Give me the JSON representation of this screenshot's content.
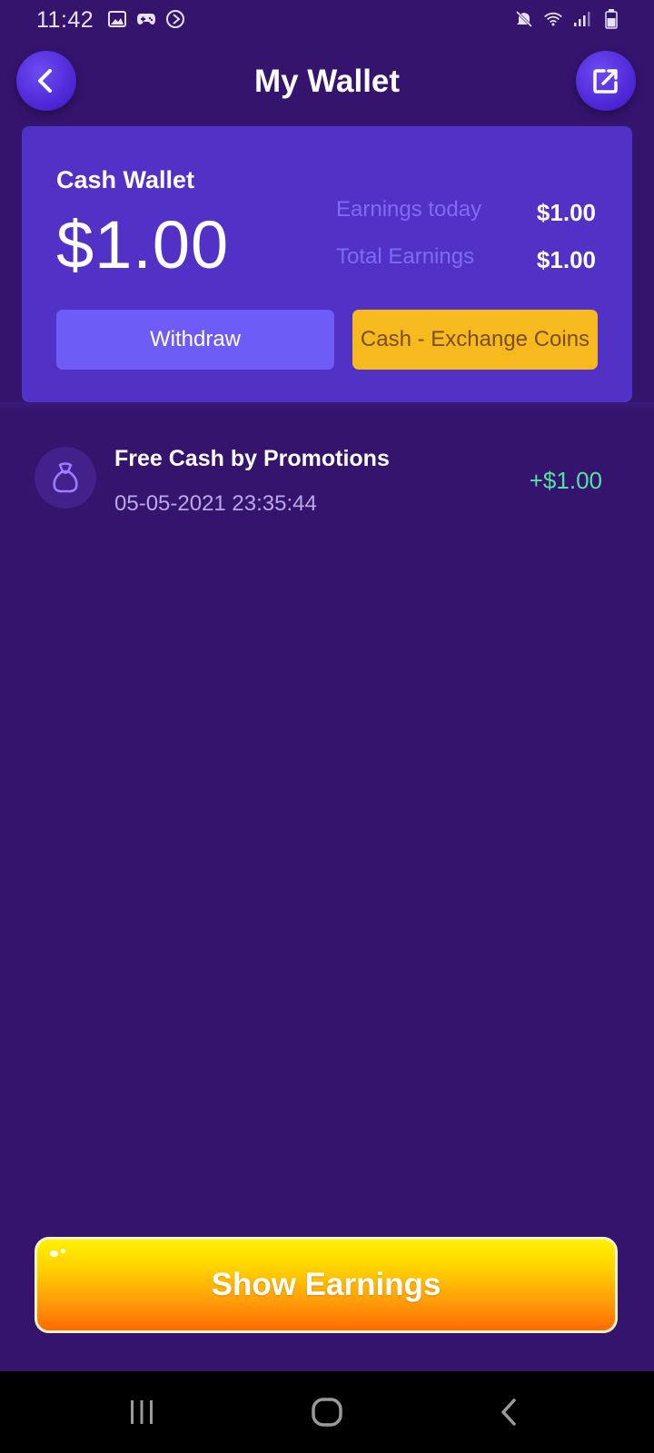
{
  "status_bar": {
    "time": "11:42",
    "left_icons": [
      "image-icon",
      "gamepad-icon",
      "play-circle-icon"
    ],
    "right_icons": [
      "mute-icon",
      "wifi-icon",
      "signal-icon",
      "battery-icon"
    ]
  },
  "header": {
    "title": "My Wallet",
    "back_icon": "chevron-left-icon",
    "share_icon": "external-link-icon"
  },
  "wallet": {
    "label": "Cash Wallet",
    "balance": "$1.00",
    "earnings_today_label": "Earnings today",
    "earnings_today_value": "$1.00",
    "total_earnings_label": "Total Earnings",
    "total_earnings_value": "$1.00",
    "withdraw_label": "Withdraw",
    "exchange_label": "Cash - Exchange Coins"
  },
  "transactions": [
    {
      "icon": "money-bag-icon",
      "title": "Free Cash by Promotions",
      "date": "05-05-2021 23:35:44",
      "amount": "+$1.00"
    }
  ],
  "show_earnings_label": "Show Earnings",
  "nav": [
    "recents-icon",
    "home-icon",
    "back-icon"
  ],
  "colors": {
    "background": "#35146E",
    "card": "#5232C6",
    "accent_button": "#6D5CF6",
    "exchange_button": "#F7BA1E",
    "positive_amount": "#54E2A0"
  }
}
